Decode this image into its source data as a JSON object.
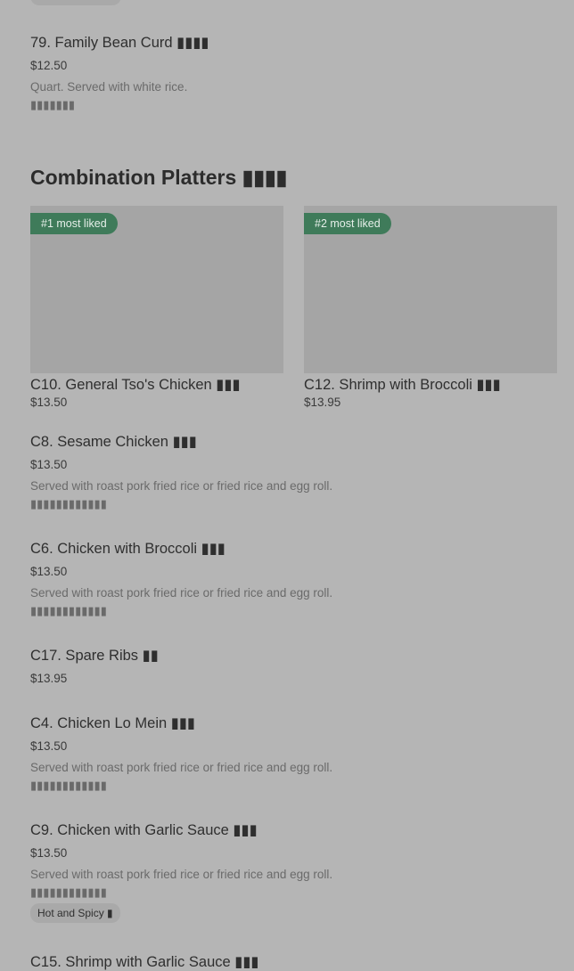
{
  "top_item": {
    "title": "79. Family Bean Curd ▮▮▮▮",
    "price": "$12.50",
    "description": "Quart. Served with white rice.",
    "foreign": "▮▮▮▮▮▮▮"
  },
  "section": {
    "title": "Combination Platters ▮▮▮▮"
  },
  "featured": [
    {
      "badge": "#1 most liked",
      "title": "C10. General Tso's Chicken ▮▮▮",
      "price": "$13.50"
    },
    {
      "badge": "#2 most liked",
      "title": "C12. Shrimp with Broccoli ▮▮▮",
      "price": "$13.95"
    }
  ],
  "items": [
    {
      "title": "C8. Sesame Chicken ▮▮▮",
      "price": "$13.50",
      "description": "Served with roast pork fried rice or fried rice and egg roll.",
      "foreign": "▮▮▮▮▮▮▮▮▮▮▮▮"
    },
    {
      "title": "C6. Chicken with Broccoli ▮▮▮",
      "price": "$13.50",
      "description": "Served with roast pork fried rice or fried rice and egg roll.",
      "foreign": "▮▮▮▮▮▮▮▮▮▮▮▮"
    },
    {
      "title": "C17. Spare Ribs ▮▮",
      "price": "$13.95"
    },
    {
      "title": "C4. Chicken Lo Mein ▮▮▮",
      "price": "$13.50",
      "description": "Served with roast pork fried rice or fried rice and egg roll.",
      "foreign": "▮▮▮▮▮▮▮▮▮▮▮▮"
    },
    {
      "title": "C9. Chicken with Garlic Sauce ▮▮▮",
      "price": "$13.50",
      "description": "Served with roast pork fried rice or fried rice and egg roll.",
      "foreign": "▮▮▮▮▮▮▮▮▮▮▮▮",
      "tag": "Hot and Spicy ▮"
    },
    {
      "title": "C15. Shrimp with Garlic Sauce ▮▮▮"
    }
  ]
}
